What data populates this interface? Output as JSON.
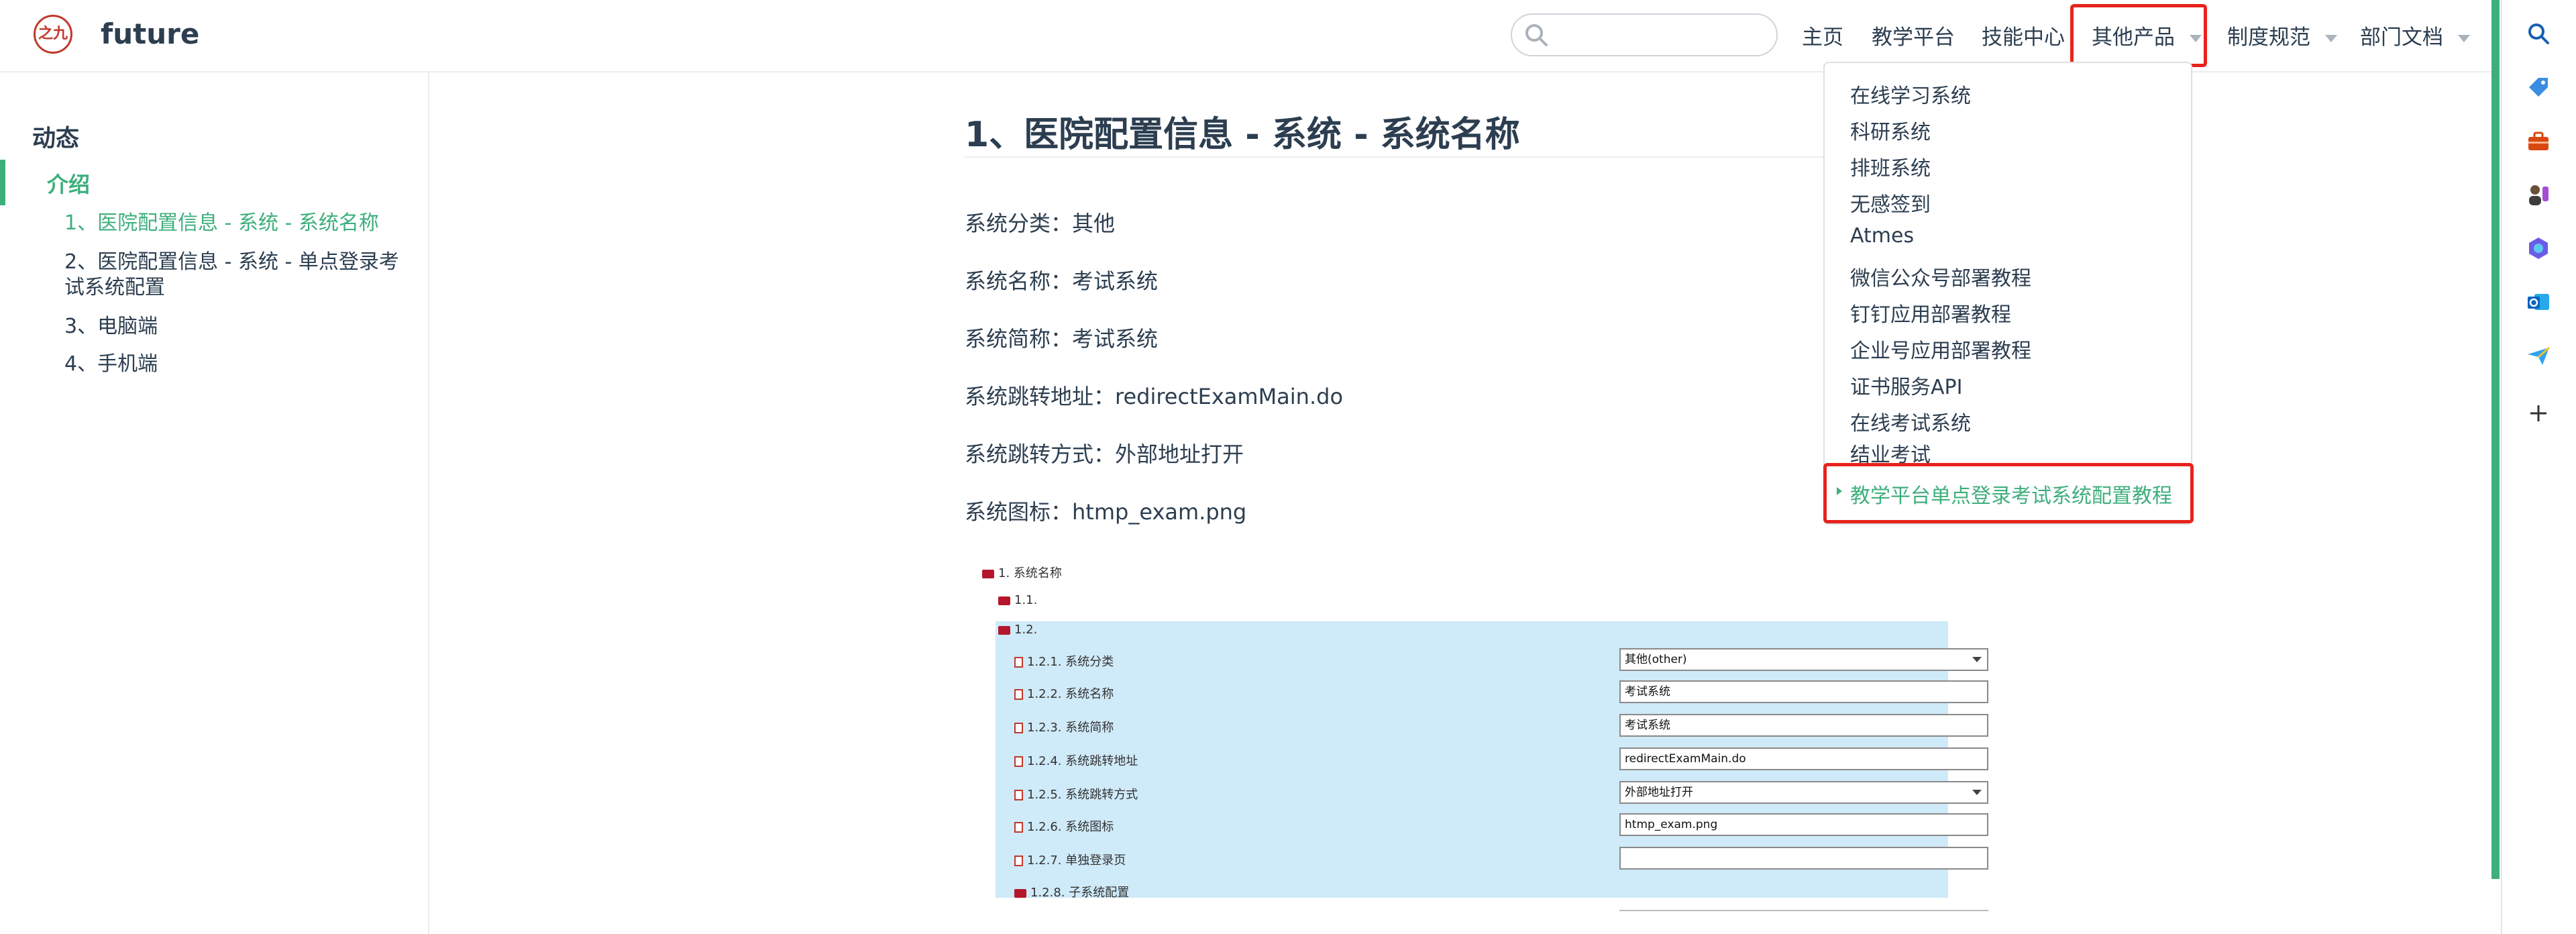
{
  "header": {
    "site_name": "future",
    "logo_text": "之九",
    "search": {
      "placeholder": "",
      "value": ""
    },
    "nav": [
      {
        "label": "主页"
      },
      {
        "label": "教学平台"
      },
      {
        "label": "技能中心"
      },
      {
        "label": "其他产品"
      },
      {
        "label": "制度规范"
      },
      {
        "label": "部门文档"
      }
    ]
  },
  "dropdown": {
    "items": [
      "在线学习系统",
      "科研系统",
      "排班系统",
      "无感签到",
      "Atmes",
      "微信公众号部署教程",
      "钉钉应用部署教程",
      "企业号应用部署教程",
      "证书服务API",
      "在线考试系统",
      "结业考试"
    ],
    "active_item": "教学平台单点登录考试系统配置教程"
  },
  "sidebar": {
    "heading": "动态",
    "active_group": "介绍",
    "links": [
      "1、医院配置信息 - 系统 - 系统名称",
      "2、医院配置信息 - 系统 - 单点登录考试系统配置",
      "3、电脑端",
      "4、手机端"
    ]
  },
  "content": {
    "title": "1、医院配置信息 - 系统 - 系统名称",
    "paragraphs": [
      "系统分类：其他",
      "系统名称：考试系统",
      "系统简称：考试系统",
      "系统跳转地址：redirectExamMain.do",
      "系统跳转方式：外部地址打开",
      "系统图标：htmp_exam.png"
    ]
  },
  "screenshot": {
    "root": "1. 系统名称",
    "node_1_1": "1.1.",
    "node_1_2": "1.2.",
    "rows": [
      {
        "label": "1.2.1. 系统分类",
        "value": "其他(other)",
        "type": "select"
      },
      {
        "label": "1.2.2. 系统名称",
        "value": "考试系统",
        "type": "input"
      },
      {
        "label": "1.2.3. 系统简称",
        "value": "考试系统",
        "type": "input"
      },
      {
        "label": "1.2.4. 系统跳转地址",
        "value": "redirectExamMain.do",
        "type": "input"
      },
      {
        "label": "1.2.5. 系统跳转方式",
        "value": "外部地址打开",
        "type": "select"
      },
      {
        "label": "1.2.6. 系统图标",
        "value": "htmp_exam.png",
        "type": "input"
      },
      {
        "label": "1.2.7. 单独登录页",
        "value": "",
        "type": "input"
      }
    ],
    "node_1_2_8": "1.2.8. 子系统配置"
  },
  "colors": {
    "accent": "#3eaf7c",
    "highlight_red": "#e8231c",
    "screenshot_bg": "#cfeaf8"
  },
  "right_panel_icons": [
    "search-icon",
    "tag-icon",
    "toolbox-icon",
    "people-icon",
    "copilot-icon",
    "outlook-icon",
    "send-icon",
    "add-icon"
  ]
}
